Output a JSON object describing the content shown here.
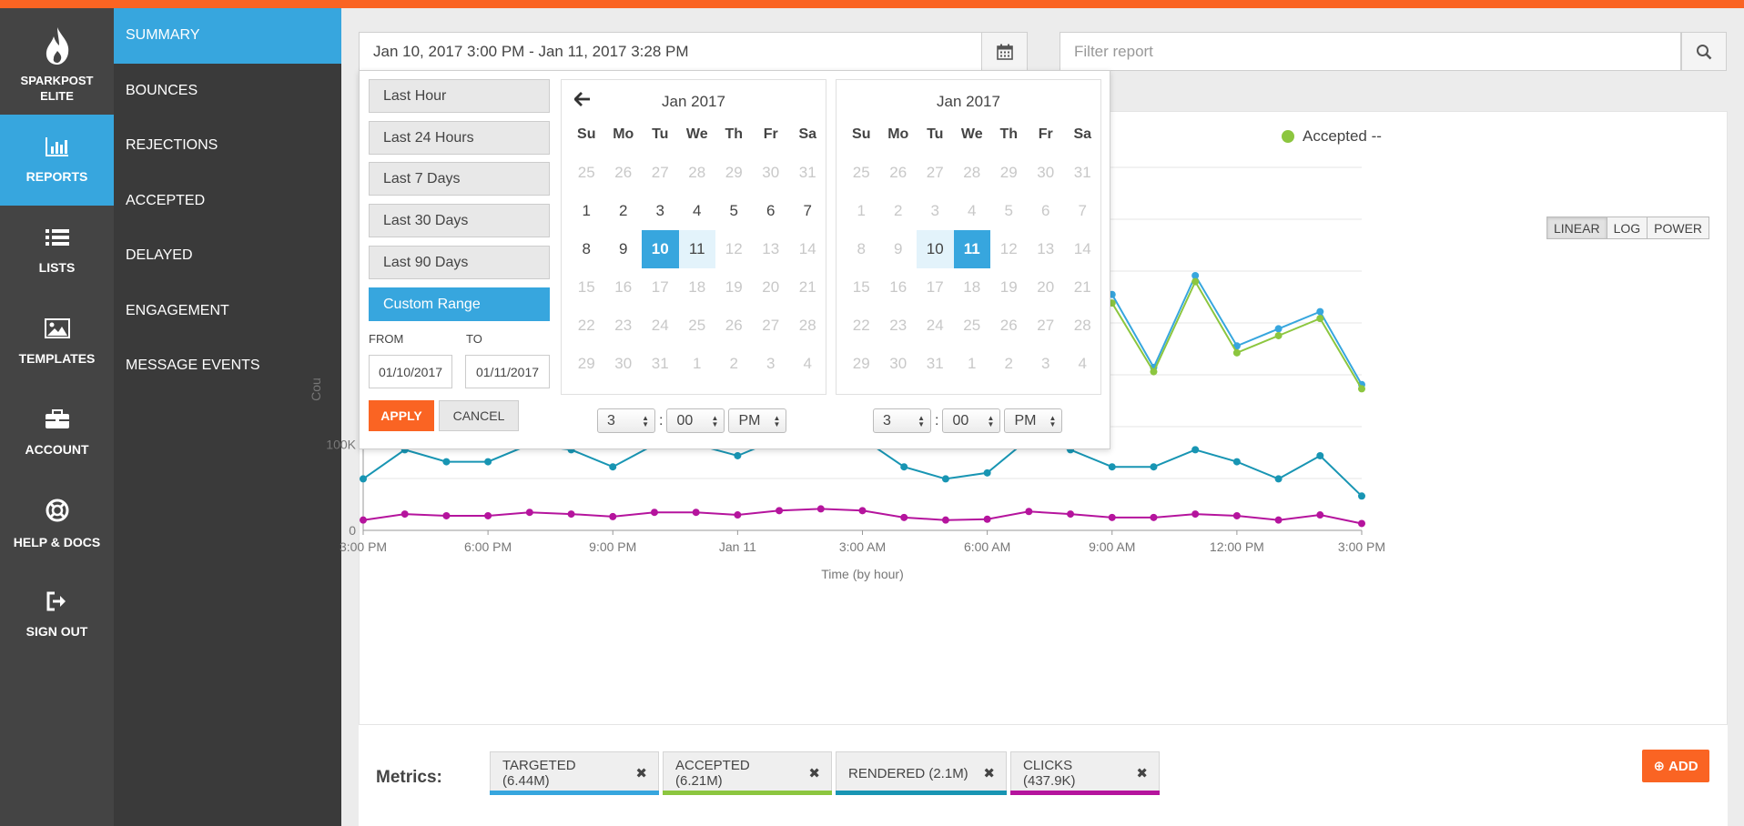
{
  "brand": {
    "line1": "SPARKPOST",
    "line2": "ELITE"
  },
  "rail": [
    {
      "label": "REPORTS",
      "icon": "bar-chart-icon",
      "active": true
    },
    {
      "label": "LISTS",
      "icon": "list-icon",
      "active": false
    },
    {
      "label": "TEMPLATES",
      "icon": "image-icon",
      "active": false
    },
    {
      "label": "ACCOUNT",
      "icon": "briefcase-icon",
      "active": false
    },
    {
      "label": "HELP & DOCS",
      "icon": "lifebuoy-icon",
      "active": false
    },
    {
      "label": "SIGN OUT",
      "icon": "sign-out-icon",
      "active": false
    }
  ],
  "subnav": [
    {
      "label": "SUMMARY",
      "active": true
    },
    {
      "label": "BOUNCES",
      "active": false
    },
    {
      "label": "REJECTIONS",
      "active": false
    },
    {
      "label": "ACCEPTED",
      "active": false
    },
    {
      "label": "DELAYED",
      "active": false
    },
    {
      "label": "ENGAGEMENT",
      "active": false
    },
    {
      "label": "MESSAGE EVENTS",
      "active": false
    }
  ],
  "date_range": "Jan 10, 2017 3:00 PM - Jan 11, 2017 3:28 PM",
  "filter": {
    "placeholder": "Filter report"
  },
  "legend_top": {
    "label": "Accepted --",
    "color": "#8cc63f"
  },
  "scale": {
    "options": [
      "LINEAR",
      "LOG",
      "POWER"
    ],
    "selected": "LINEAR"
  },
  "picker": {
    "presets": [
      "Last Hour",
      "Last 24 Hours",
      "Last 7 Days",
      "Last 30 Days",
      "Last 90 Days",
      "Custom Range"
    ],
    "active_preset": "Custom Range",
    "from_label": "FROM",
    "to_label": "TO",
    "from_value": "01/10/2017",
    "to_value": "01/11/2017",
    "apply_label": "APPLY",
    "cancel_label": "CANCEL",
    "calendars": [
      {
        "title": "Jan 2017",
        "start_hour": "3",
        "start_min": "00",
        "start_ampm": "PM"
      },
      {
        "title": "Jan 2017",
        "start_hour": "3",
        "start_min": "00",
        "start_ampm": "PM"
      }
    ],
    "weekdays": [
      "Su",
      "Mo",
      "Tu",
      "We",
      "Th",
      "Fr",
      "Sa"
    ],
    "days": [
      "25",
      "26",
      "27",
      "28",
      "29",
      "30",
      "31",
      "1",
      "2",
      "3",
      "4",
      "5",
      "6",
      "7",
      "8",
      "9",
      "10",
      "11",
      "12",
      "13",
      "14",
      "15",
      "16",
      "17",
      "18",
      "19",
      "20",
      "21",
      "22",
      "23",
      "24",
      "25",
      "26",
      "27",
      "28",
      "29",
      "30",
      "31",
      "1",
      "2",
      "3",
      "4"
    ],
    "separator": ":"
  },
  "chart_data": {
    "type": "line",
    "x": [
      "3:00 PM",
      "4:00 PM",
      "5:00 PM",
      "6:00 PM",
      "7:00 PM",
      "8:00 PM",
      "9:00 PM",
      "10:00 PM",
      "11:00 PM",
      "Jan 11",
      "1:00 AM",
      "2:00 AM",
      "3:00 AM",
      "4:00 AM",
      "5:00 AM",
      "6:00 AM",
      "7:00 AM",
      "8:00 AM",
      "9:00 AM",
      "10:00 AM",
      "11:00 AM",
      "12:00 PM",
      "1:00 PM",
      "2:00 PM",
      "3:00 PM"
    ],
    "x_ticks": [
      "3:00 PM",
      "6:00 PM",
      "9:00 PM",
      "Jan 11",
      "3:00 AM",
      "6:00 AM",
      "9:00 AM",
      "12:00 PM",
      "3:00 PM"
    ],
    "xlabel": "Time (by hour)",
    "ylabel": "Cou",
    "y_ticks": [
      "0",
      "100K"
    ],
    "ylim": [
      0,
      350000
    ],
    "grid": true,
    "series": [
      {
        "name": "Targeted",
        "color": "#37a6de",
        "partial": true,
        "values": [
          null,
          null,
          null,
          null,
          null,
          null,
          null,
          null,
          null,
          null,
          null,
          null,
          null,
          null,
          255000,
          275000,
          275000,
          340000,
          275000,
          190000,
          297000,
          215000,
          235000,
          255000,
          170000
        ]
      },
      {
        "name": "Accepted",
        "color": "#8cc63f",
        "partial": true,
        "values": [
          null,
          null,
          null,
          null,
          null,
          null,
          null,
          null,
          null,
          null,
          null,
          null,
          null,
          null,
          247000,
          265000,
          265000,
          330000,
          265000,
          185000,
          290000,
          207000,
          227000,
          247000,
          165000
        ]
      },
      {
        "name": "Rendered",
        "color": "#1895b3",
        "values": [
          60000,
          94000,
          80000,
          80000,
          100000,
          94000,
          74000,
          100000,
          100000,
          87000,
          107000,
          120000,
          107000,
          74000,
          60000,
          67000,
          107000,
          94000,
          74000,
          74000,
          94000,
          80000,
          60000,
          87000,
          40000
        ]
      },
      {
        "name": "Clicks",
        "color": "#b5149d",
        "values": [
          12000,
          19000,
          17000,
          17000,
          21000,
          19000,
          16000,
          21000,
          21000,
          18000,
          23000,
          25000,
          23000,
          15000,
          12000,
          13000,
          22000,
          19000,
          15000,
          15000,
          19000,
          17000,
          12000,
          18000,
          8000
        ]
      }
    ]
  },
  "metrics_label": "Metrics:",
  "metrics": [
    {
      "label": "TARGETED (6.44M)",
      "color": "#37a6de"
    },
    {
      "label": "ACCEPTED (6.21M)",
      "color": "#8cc63f"
    },
    {
      "label": "RENDERED (2.1M)",
      "color": "#1895b3"
    },
    {
      "label": "CLICKS (437.9K)",
      "color": "#b5149d"
    }
  ],
  "add_label": "ADD",
  "remove_glyph": "✖",
  "add_glyph": "⊕"
}
